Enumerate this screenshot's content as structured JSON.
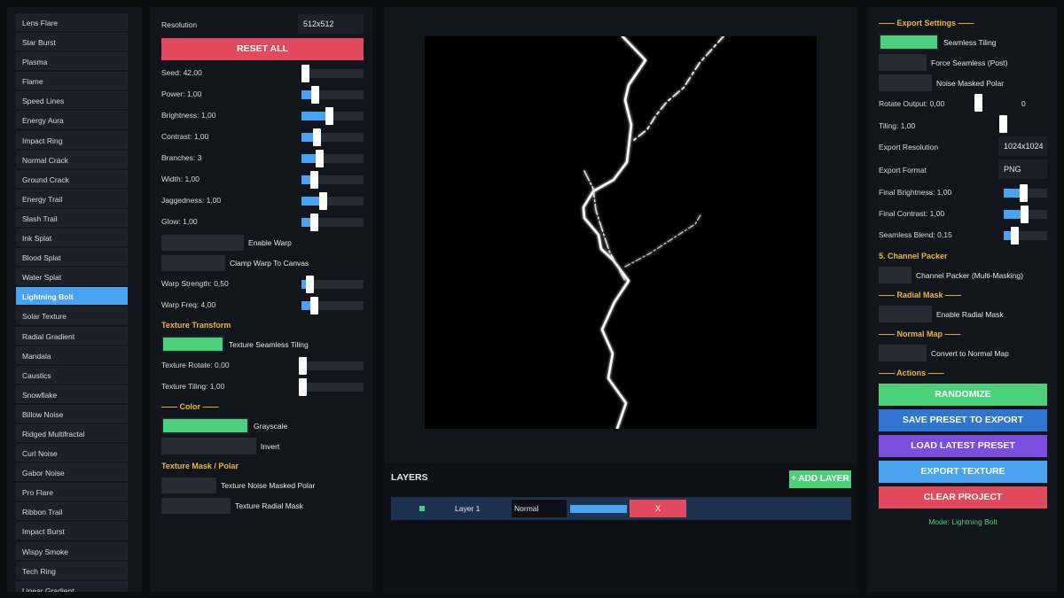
{
  "sidebar": {
    "items": [
      "Lens Flare",
      "Star Burst",
      "Plasma",
      "Flame",
      "Speed Lines",
      "Energy Aura",
      "Impact Ring",
      "Normal Crack",
      "Ground Crack",
      "Energy Trail",
      "Slash Trail",
      "Ink Splat",
      "Blood Splat",
      "Water Splat",
      "Lightning Bolt",
      "Solar Texture",
      "Radial Gradient",
      "Mandala",
      "Caustics",
      "Snowflake",
      "Billow Noise",
      "Ridged Multifractal",
      "Curl Noise",
      "Gabor Noise",
      "Pro Flare",
      "Ribbon Trail",
      "Impact Burst",
      "Wispy Smoke",
      "Tech Ring",
      "Linear Gradient"
    ],
    "active_index": 14
  },
  "params": {
    "resolution_label": "Resolution",
    "resolution_value": "512x512",
    "reset_label": "RESET ALL",
    "sliders": [
      {
        "label": "Seed: 42,00",
        "fraction": 0.0
      },
      {
        "label": "Power: 1,00",
        "fraction": 0.18
      },
      {
        "label": "Brightness: 1,00",
        "fraction": 0.45
      },
      {
        "label": "Contrast: 1,00",
        "fraction": 0.22
      },
      {
        "label": "Branches: 3",
        "fraction": 0.26
      },
      {
        "label": "Width: 1,00",
        "fraction": 0.16
      },
      {
        "label": "Jaggedness: 1,00",
        "fraction": 0.32
      },
      {
        "label": "Glow: 1,00",
        "fraction": 0.16
      }
    ],
    "enable_warp_label": "Enable Warp",
    "clamp_warp_label": "Clamp Warp To Canvas",
    "warp_sliders": [
      {
        "label": "Warp Strength: 0,50",
        "fraction": 0.08
      },
      {
        "label": "Warp Freq: 4,00",
        "fraction": 0.16
      }
    ],
    "texture_transform_title": "Texture Transform",
    "texture_seamless_label": "Texture Seamless Tiling",
    "texture_sliders": [
      {
        "label": "Texture Rotate: 0,00",
        "fraction": 0.0
      },
      {
        "label": "Texture Tiling: 1,00",
        "fraction": 0.0
      }
    ],
    "color_title": "—— Color ——",
    "grayscale_label": "Grayscale",
    "invert_label": "Invert",
    "mask_title": "Texture Mask / Polar",
    "noise_masked_polar_label": "Texture Noise Masked Polar",
    "radial_mask_label": "Texture Radial Mask"
  },
  "layers": {
    "title": "LAYERS",
    "add_label": "+ ADD LAYER",
    "rows": [
      {
        "name": "Layer 1",
        "blend": "Normal",
        "delete_label": "X",
        "opacity": 1.0
      }
    ]
  },
  "export": {
    "title": "—— Export Settings ——",
    "seamless_label": "Seamless Tiling",
    "force_seamless_label": "Force Seamless (Post)",
    "noise_masked_polar_label": "Noise Masked Polar",
    "rotate_label": "Rotate Output: 0,00",
    "rotate_value": "0",
    "tiling_label": "Tiling: 1,00",
    "resolution_label": "Export Resolution",
    "resolution_value": "1024x1024",
    "format_label": "Export Format",
    "format_value": "PNG",
    "final_sliders": [
      {
        "label": "Final Brightness: 1,00",
        "fraction": 0.45
      },
      {
        "label": "Final Contrast: 1,00",
        "fraction": 0.47
      },
      {
        "label": "Seamless Blend: 0,15",
        "fraction": 0.2
      }
    ],
    "channel_packer_title": "5. Channel Packer",
    "channel_packer_label": "Channel Packer (Multi-Masking)",
    "radial_mask_title": "—— Radial Mask ——",
    "radial_mask_label": "Enable Radial Mask",
    "normal_map_title": "—— Normal Map ——",
    "normal_map_label": "Convert to Normal Map",
    "actions_title": "—— Actions ——",
    "randomize_label": "RANDOMIZE",
    "save_preset_label": "SAVE PRESET TO EXPORT",
    "load_preset_label": "LOAD LATEST PRESET",
    "export_texture_label": "EXPORT TEXTURE",
    "clear_project_label": "CLEAR PROJECT",
    "mode_text": "Mode: Lightning Bolt"
  },
  "colors": {
    "accent_blue": "#4aa3f0",
    "accent_green": "#4ad17a",
    "accent_red": "#e04a5c",
    "accent_purple": "#7a4fe0",
    "section_gold": "#e8b64a"
  }
}
